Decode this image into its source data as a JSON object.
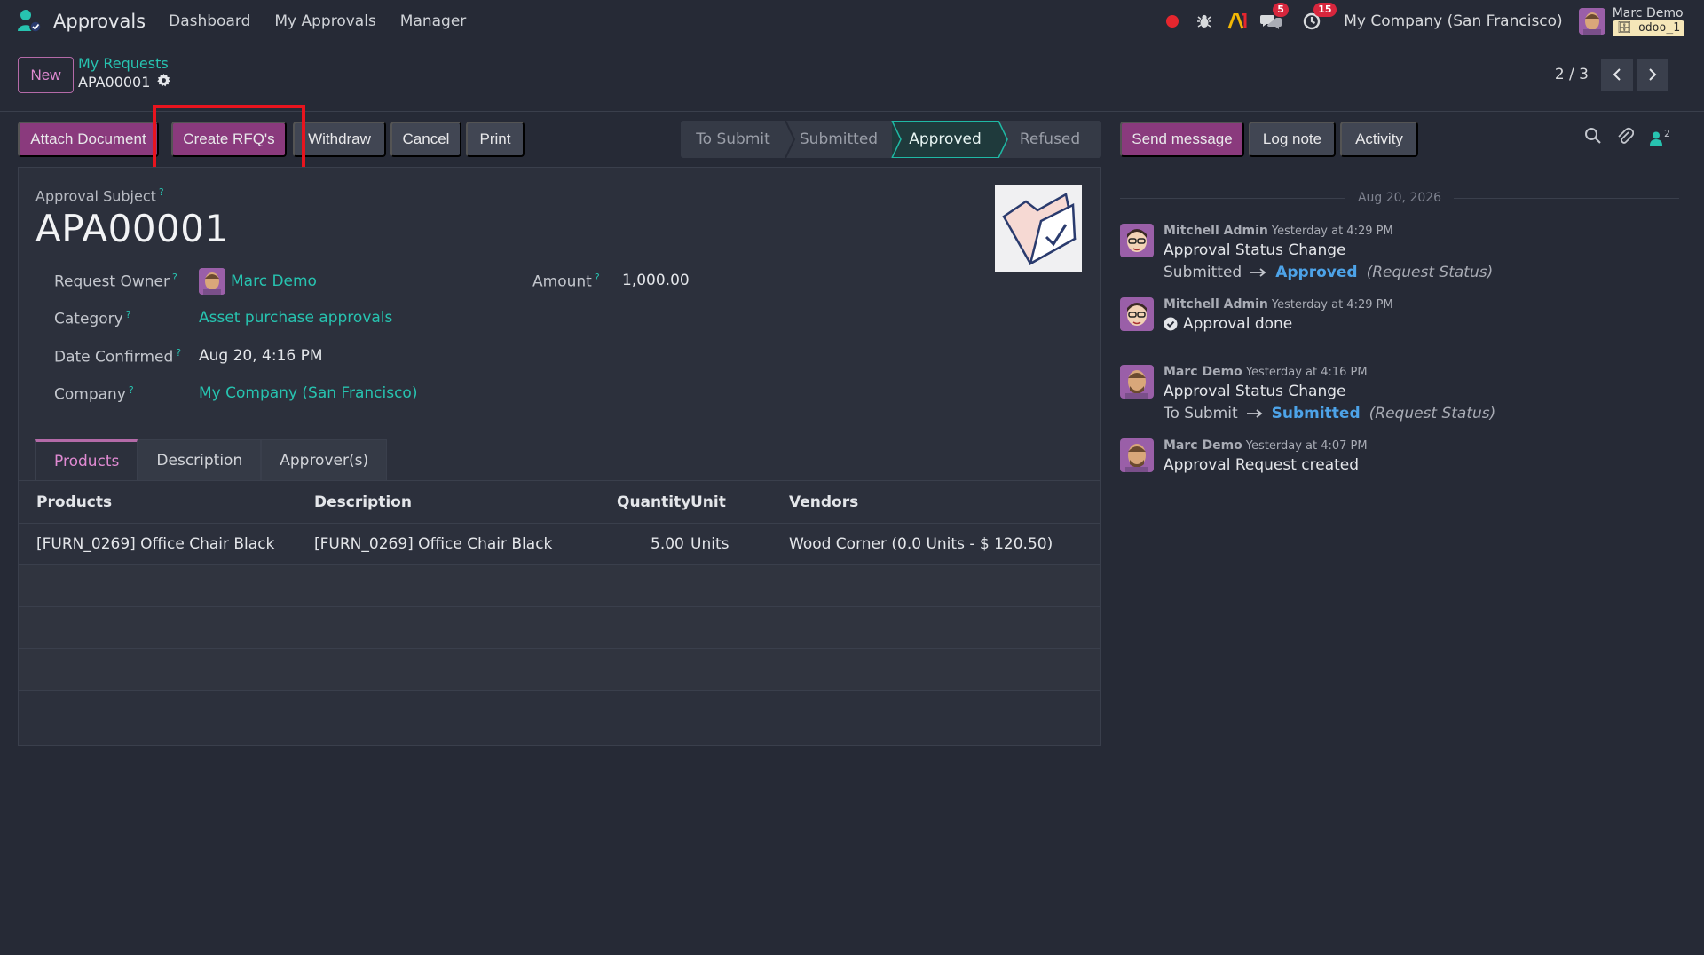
{
  "nav": {
    "app_title": "Approvals",
    "menu": [
      "Dashboard",
      "My Approvals",
      "Manager"
    ],
    "messages_count": "5",
    "activities_count": "15",
    "company": "My Company (San Francisco)",
    "user_name": "Marc Demo",
    "database": "odoo_1"
  },
  "control": {
    "new_label": "New",
    "breadcrumb_parent": "My Requests",
    "breadcrumb_current": "APA00001",
    "pager": "2 / 3"
  },
  "actions": {
    "attach": "Attach Document",
    "create_rfq": "Create RFQ's",
    "withdraw": "Withdraw",
    "cancel": "Cancel",
    "print": "Print"
  },
  "status": {
    "stages": [
      "To Submit",
      "Submitted",
      "Approved",
      "Refused"
    ],
    "current": "Approved"
  },
  "form": {
    "subject_label": "Approval Subject",
    "subject": "APA00001",
    "owner_label": "Request Owner",
    "owner": "Marc Demo",
    "amount_label": "Amount",
    "amount": "1,000.00",
    "category_label": "Category",
    "category": "Asset purchase approvals",
    "date_label": "Date Confirmed",
    "date": "Aug 20, 4:16 PM",
    "company_label": "Company",
    "company": "My Company (San Francisco)"
  },
  "tabs": [
    "Products",
    "Description",
    "Approver(s)"
  ],
  "table": {
    "headers": [
      "Products",
      "Description",
      "Quantity",
      "Unit",
      "Vendors"
    ],
    "rows": [
      {
        "product": "[FURN_0269] Office Chair Black",
        "description": "[FURN_0269] Office Chair Black",
        "quantity": "5.00",
        "unit": "Units",
        "vendor": "Wood Corner (0.0 Units - $ 120.50)"
      }
    ]
  },
  "chatter": {
    "send_message": "Send message",
    "log_note": "Log note",
    "activity": "Activity",
    "followers_count": "2",
    "date_separator": "Aug 20, 2026",
    "messages": [
      {
        "author": "Mitchell Admin",
        "date": "Yesterday at 4:29 PM",
        "text": "Approval Status Change",
        "old": "Submitted",
        "new": "Approved",
        "field": "(Request Status)"
      },
      {
        "author": "Mitchell Admin",
        "date": "Yesterday at 4:29 PM",
        "text": "Approval done"
      },
      {
        "author": "Marc Demo",
        "date": "Yesterday at 4:16 PM",
        "text": "Approval Status Change",
        "old": "To Submit",
        "new": "Submitted",
        "field": "(Request Status)"
      },
      {
        "author": "Marc Demo",
        "date": "Yesterday at 4:07 PM",
        "text": "Approval Request created"
      }
    ]
  },
  "colors": {
    "brand": "#8a3a7d",
    "link": "#27c3b0",
    "background": "#262a36",
    "badge": "#d7263d"
  }
}
